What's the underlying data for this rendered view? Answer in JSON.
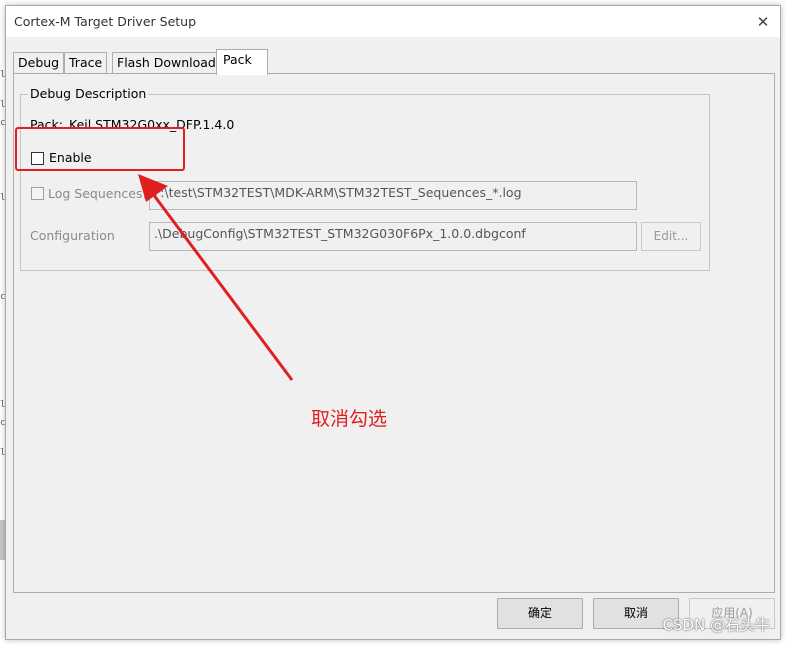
{
  "dialog": {
    "title": "Cortex-M Target Driver Setup",
    "close_glyph": "✕"
  },
  "tabs": [
    {
      "label": "Debug"
    },
    {
      "label": "Trace"
    },
    {
      "label": "Flash Download"
    },
    {
      "label": "Pack"
    }
  ],
  "active_tab": "Pack",
  "group": {
    "legend": "Debug Description",
    "pack_label": "Pack:",
    "pack_value": "Keil.STM32G0xx_DFP.1.4.0",
    "enable_label": "Enable",
    "enable_checked": false,
    "log_label": "Log Sequences:",
    "log_checked": false,
    "log_value": "F:\\test\\STM32TEST\\MDK-ARM\\STM32TEST_Sequences_*.log",
    "config_label": "Configuration",
    "config_value": ".\\DebugConfig\\STM32TEST_STM32G030F6Px_1.0.0.dbgconf",
    "edit_button": "Edit..."
  },
  "buttons": {
    "ok": "确定",
    "cancel": "取消",
    "apply": "应用(A)"
  },
  "annotation": {
    "text": "取消勾选",
    "color": "#e02020"
  },
  "watermark": "CSDN @石头牛"
}
